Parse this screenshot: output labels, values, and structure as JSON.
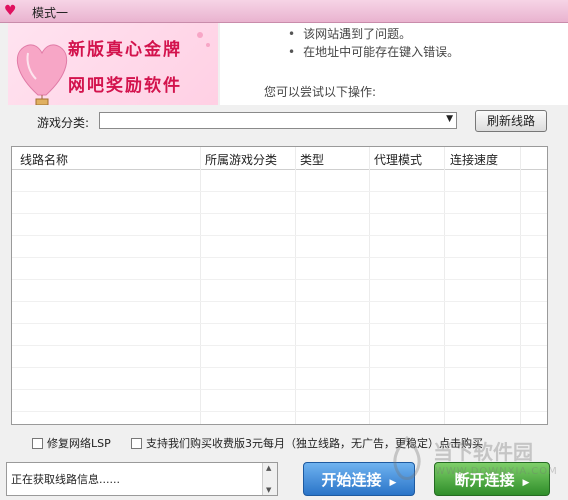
{
  "window": {
    "title": "模式一",
    "app_icon": "heart-icon"
  },
  "banner": {
    "line1": "新版真心金牌",
    "line2": "网吧奖励软件",
    "accent_color": "#d3134d"
  },
  "browser_error": {
    "bullets": [
      "该网站遇到了问题。",
      "在地址中可能存在键入错误。"
    ],
    "try_text": "您可以尝试以下操作:"
  },
  "filter": {
    "label": "游戏分类:",
    "selected": "",
    "refresh_label": "刷新线路"
  },
  "table": {
    "columns": [
      "线路名称",
      "所属游戏分类",
      "类型",
      "代理模式",
      "连接速度"
    ],
    "rows": []
  },
  "options": {
    "repair_lsp": "修复网络LSP",
    "support_paid": "支持我们购买收费版3元每月（独立线路，无广告，更稳定）点击购买"
  },
  "status": {
    "text": "正在获取线路信息......"
  },
  "actions": {
    "start_label": "开始连接",
    "stop_label": "断开连接",
    "start_color": "#2a74c8",
    "stop_color": "#2f8e2a"
  },
  "watermark": {
    "text": "当下软件园",
    "sub": "WWW.DOWNXIA.COM"
  }
}
